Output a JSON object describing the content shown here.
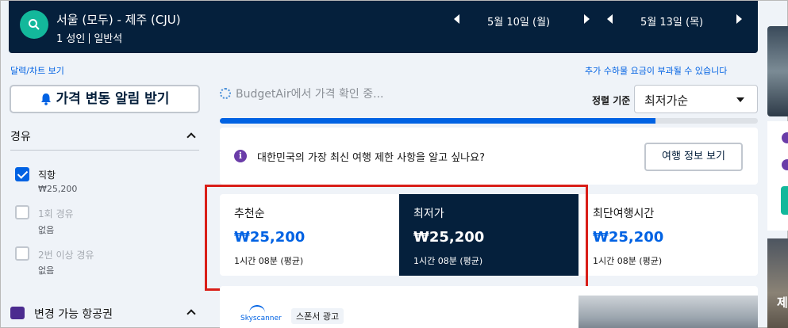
{
  "header": {
    "route": "서울 (모두) - 제주 (CJU)",
    "passengers": "1 성인",
    "cabin": "일반석",
    "depart_date": "5월 10일 (월)",
    "return_date": "5월 13일 (목)"
  },
  "links": {
    "calendar": "달력/차트 보기",
    "fees_notice": "추가 수하물 요금이 부과될 수 있습니다"
  },
  "price_alert": {
    "label": "가격 변동 알림 받기"
  },
  "filters": {
    "stops_title": "경유",
    "options": [
      {
        "label": "직항",
        "sub": "₩25,200",
        "checked": true
      },
      {
        "label": "1회 경유",
        "sub": "없음",
        "checked": false
      },
      {
        "label": "2번 이상 경유",
        "sub": "없음",
        "checked": false
      }
    ],
    "airline_title": "변경 가능 항공권"
  },
  "results": {
    "loading_text": "BudgetAir에서 가격 확인 중...",
    "sort_label": "정렬 기준",
    "sort_value": "최저가순",
    "progress": 0.81,
    "info_text": "대한민국의 가장 최신 여행 제한 사항을 알고 싶나요?",
    "info_button": "여행 정보 보기",
    "tabs": [
      {
        "name": "추천순",
        "price": "₩25,200",
        "duration": "1시간 08분 (평균)",
        "selected": false
      },
      {
        "name": "최저가",
        "price": "₩25,200",
        "duration": "1시간 08분 (평균)",
        "selected": true
      },
      {
        "name": "최단여행시간",
        "price": "₩25,200",
        "duration": "1시간 08분 (평균)",
        "selected": false
      }
    ],
    "ad": {
      "brand": "Skyscanner",
      "sponsor_label": "스폰서 광고"
    }
  },
  "right_rail": {
    "peek_text": "제"
  },
  "colors": {
    "navy": "#05203c",
    "blue": "#0062e3",
    "teal": "#13b89b",
    "highlight": "#d91e18"
  },
  "icons": [
    "search-icon",
    "chevron-left-icon",
    "chevron-right-icon",
    "bell-icon",
    "info-icon",
    "chevron-up-icon",
    "dropdown-arrow-icon",
    "airline-icon"
  ]
}
